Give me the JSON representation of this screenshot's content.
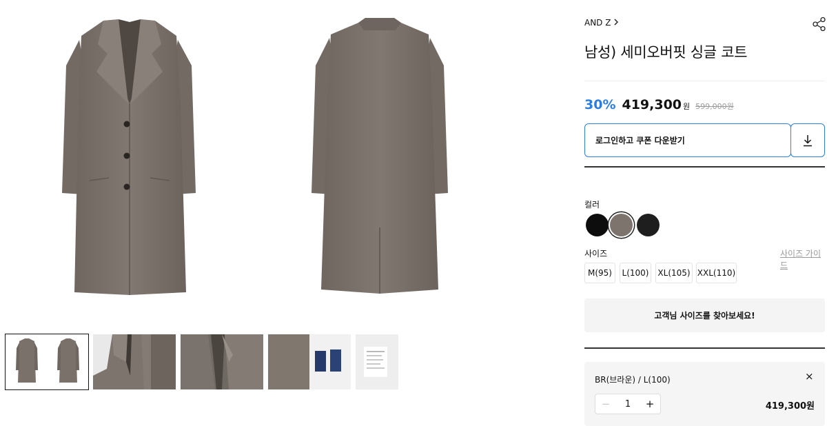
{
  "product": {
    "brand": "AND Z",
    "title": "남성) 세미오버핏 싱글 코트",
    "discount": "30%",
    "price": "419,300",
    "price_unit": "원",
    "original_price": "599,000원"
  },
  "coupon": {
    "label": "로그인하고 쿠폰 다운받기"
  },
  "color": {
    "label": "컬러",
    "swatches": [
      "#0d0d0d",
      "#7e746e",
      "#1e1e1e"
    ],
    "selected_index": 1
  },
  "size": {
    "label": "사이즈",
    "guide_label": "사이즈 가이드",
    "options": [
      "M(95)",
      "L(100)",
      "XL(105)",
      "XXL(110)"
    ]
  },
  "find_size": {
    "label": "고객님 사이즈를 찾아보세요!"
  },
  "selected": {
    "option": "BR(브라운) / L(100)",
    "remove": "×",
    "minus": "−",
    "quantity": "1",
    "plus": "+",
    "line_price": "419,300원"
  },
  "gallery": {
    "thumbnail_count": 5,
    "active_index": 0,
    "coat_color": "#7b716b"
  }
}
